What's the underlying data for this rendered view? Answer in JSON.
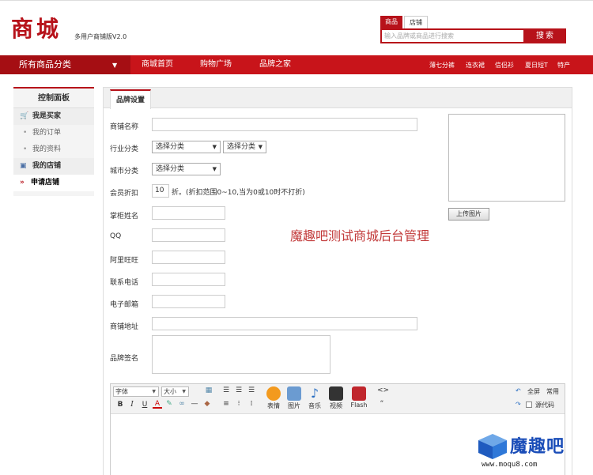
{
  "header": {
    "logo_text": "商城",
    "version": "多用户商铺版V2.0",
    "search_tabs": [
      "商品",
      "店铺"
    ],
    "search_placeholder": "输入品牌或商品进行搜索",
    "search_button": "搜索"
  },
  "nav": {
    "all_categories": "所有商品分类",
    "items": [
      "商城首页",
      "购物广场",
      "品牌之家"
    ],
    "right_links": [
      "薄七分裤",
      "连衣裙",
      "信侣衫",
      "夏日短T",
      "特产"
    ]
  },
  "sidebar": {
    "title": "控制面板",
    "buyer_head": "我是买家",
    "buyer_links": [
      "我的订单",
      "我的资料"
    ],
    "shop_head": "我的店铺",
    "apply_shop": "申请店铺"
  },
  "main": {
    "tab": "品牌设置",
    "fields": {
      "shop_name": "商铺名称",
      "industry": "行业分类",
      "city": "城市分类",
      "member_discount": "会员折扣",
      "owner_name": "掌柜姓名",
      "qq": "QQ",
      "aliwangwang": "阿里旺旺",
      "phone": "联系电话",
      "email": "电子邮箱",
      "address": "商铺地址",
      "signature": "品牌签名"
    },
    "select_placeholder": "选择分类",
    "discount_value": "10",
    "discount_note": "折。(折扣范围0~10,当为0或10时不打折)",
    "upload_button": "上传图片",
    "watermark": "魔趣吧测试商城后台管理"
  },
  "editor": {
    "font_label": "字体",
    "size_label": "大小",
    "emoji_label": "表情",
    "image_label": "图片",
    "music_label": "音乐",
    "video_label": "视频",
    "flash_label": "Flash",
    "fullscreen_label": "全屏",
    "common_label": "常用",
    "source_label": "源代码",
    "format_glyphs": [
      "B",
      "I",
      "U",
      "A"
    ]
  },
  "corner_logo": {
    "brand": "魔趣吧",
    "url": "www.moqu8.com"
  }
}
